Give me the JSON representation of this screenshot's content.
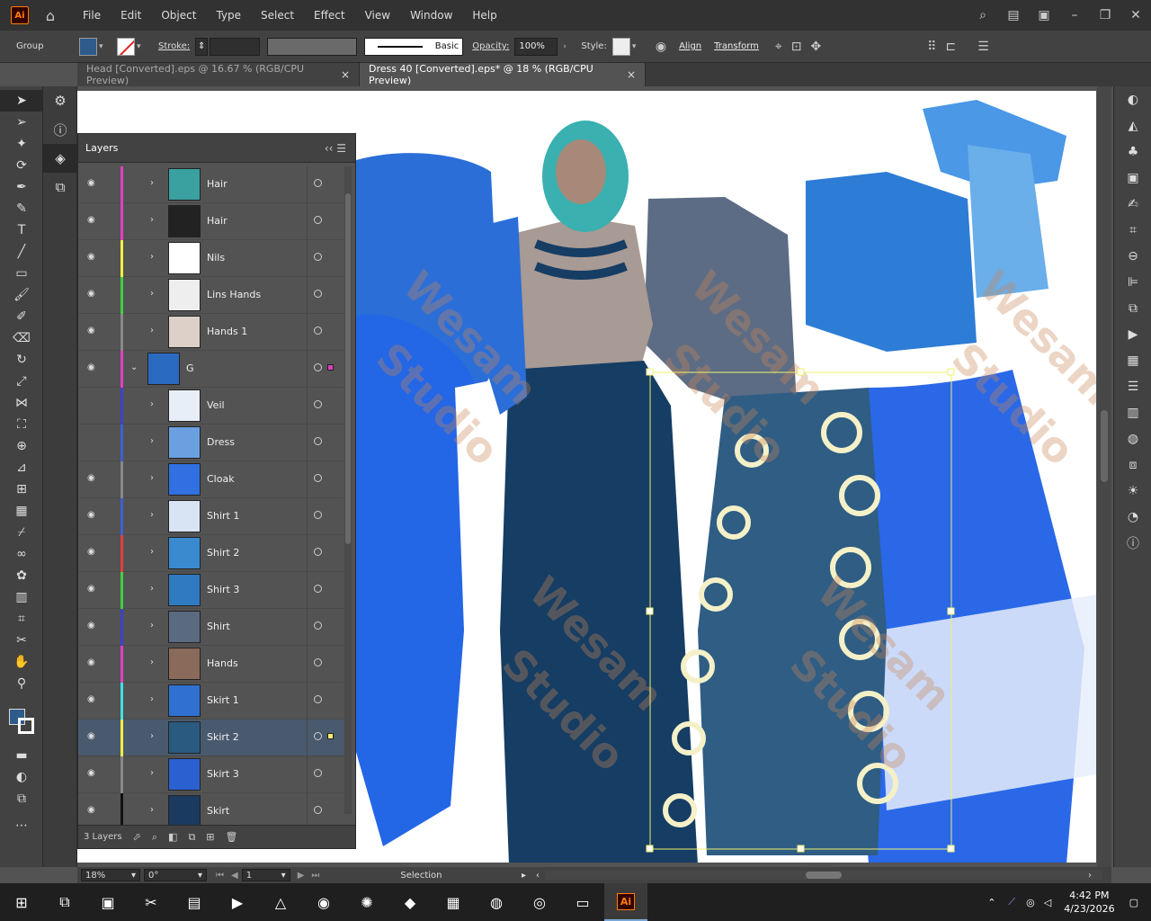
{
  "app": {
    "logo": "Ai"
  },
  "menu": [
    "File",
    "Edit",
    "Object",
    "Type",
    "Select",
    "Effect",
    "View",
    "Window",
    "Help"
  ],
  "controlbar": {
    "selection_type": "Group",
    "stroke_label": "Stroke:",
    "brush_label": "Basic",
    "opacity_label": "Opacity:",
    "opacity_value": "100%",
    "style_label": "Style:",
    "align_link": "Align",
    "transform_link": "Transform",
    "fill_color": "#2e5b8c"
  },
  "tabs": [
    {
      "label": "Head [Converted].eps @ 16.67 % (RGB/CPU Preview)",
      "active": false
    },
    {
      "label": "Dress 40 [Converted].eps* @ 18 % (RGB/CPU Preview)",
      "active": true
    }
  ],
  "layers_panel": {
    "title": "Layers",
    "footer_count": "3 Layers",
    "rows": [
      {
        "name": "Hair",
        "color": "#e040c0",
        "thumb": "#3aa0a0",
        "eye": true,
        "arrow": "›",
        "indent": false
      },
      {
        "name": "Hair",
        "color": "#e040c0",
        "thumb": "#222222",
        "eye": true,
        "arrow": "›",
        "indent": false
      },
      {
        "name": "Nils",
        "color": "#f0f040",
        "thumb": "#ffffff",
        "eye": true,
        "arrow": "›",
        "indent": false
      },
      {
        "name": "Lins Hands",
        "color": "#40d040",
        "thumb": "#eeeeee",
        "eye": true,
        "arrow": "›",
        "indent": false
      },
      {
        "name": "Hands 1",
        "color": "#888888",
        "thumb": "#ddd0c8",
        "eye": true,
        "arrow": "›",
        "indent": false
      },
      {
        "name": "G",
        "color": "#e040c0",
        "thumb": "#2a6ac0",
        "eye": true,
        "arrow": "⌄",
        "indent": true
      },
      {
        "name": "Veil",
        "color": "#4040d0",
        "thumb": "#e8eef8",
        "eye": false,
        "arrow": "›",
        "indent": false
      },
      {
        "name": "Dress",
        "color": "#4060d0",
        "thumb": "#6aa0e0",
        "eye": false,
        "arrow": "›",
        "indent": false
      },
      {
        "name": "Cloak",
        "color": "#888888",
        "thumb": "#3070e0",
        "eye": true,
        "arrow": "›",
        "indent": false
      },
      {
        "name": "Shirt 1",
        "color": "#4060d0",
        "thumb": "#d8e4f4",
        "eye": true,
        "arrow": "›",
        "indent": false
      },
      {
        "name": "Shirt 2",
        "color": "#e04040",
        "thumb": "#3a8ad0",
        "eye": true,
        "arrow": "›",
        "indent": false
      },
      {
        "name": "Shirt 3",
        "color": "#40d040",
        "thumb": "#2f7ac0",
        "eye": true,
        "arrow": "›",
        "indent": false
      },
      {
        "name": "Shirt",
        "color": "#4040d0",
        "thumb": "#5a6a80",
        "eye": true,
        "arrow": "›",
        "indent": false
      },
      {
        "name": "Hands",
        "color": "#e040c0",
        "thumb": "#8a6a5a",
        "eye": true,
        "arrow": "›",
        "indent": false
      },
      {
        "name": "Skirt 1",
        "color": "#40e0e0",
        "thumb": "#3070d0",
        "eye": true,
        "arrow": "›",
        "indent": false
      },
      {
        "name": "Skirt 2",
        "color": "#f0f040",
        "thumb": "#2a5a80",
        "eye": true,
        "arrow": "›",
        "indent": false,
        "selected": true
      },
      {
        "name": "Skirt 3",
        "color": "#888888",
        "thumb": "#2a60d0",
        "eye": true,
        "arrow": "›",
        "indent": false
      },
      {
        "name": "Skirt",
        "color": "#111111",
        "thumb": "#1a3a60",
        "eye": true,
        "arrow": "›",
        "indent": false
      }
    ]
  },
  "statusbar": {
    "zoom": "18%",
    "rotation": "0°",
    "artboard": "1",
    "tool": "Selection"
  },
  "watermark": {
    "line1": "Wesam",
    "line2": "Studio"
  },
  "taskbar": {
    "time": "4:42 PM",
    "date": "4/23/2026"
  }
}
